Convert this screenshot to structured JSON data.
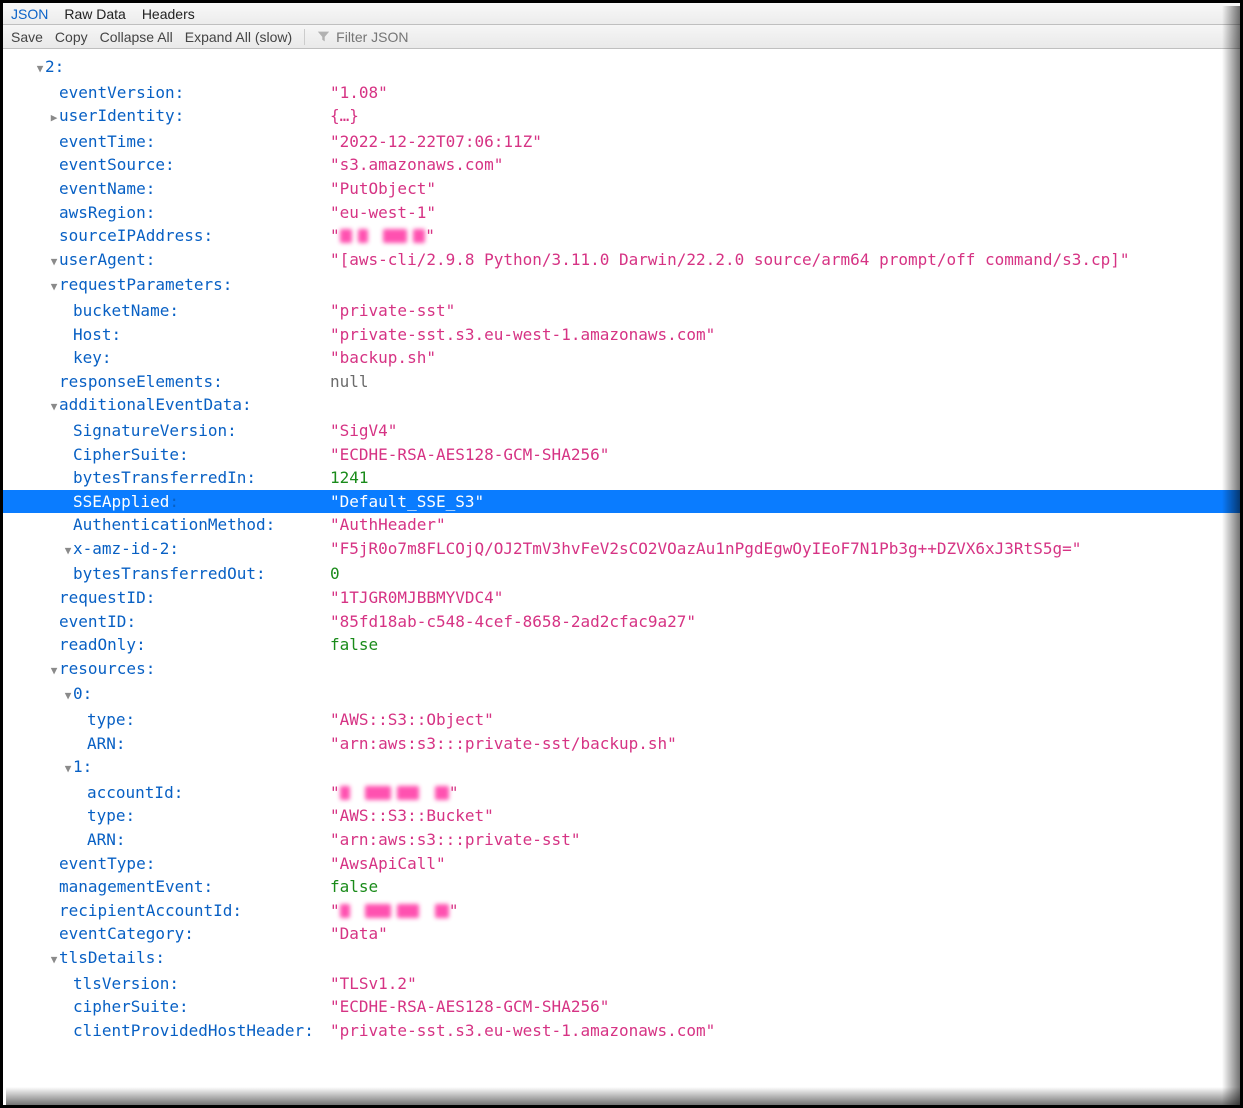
{
  "tabs": {
    "json": "JSON",
    "raw": "Raw Data",
    "headers": "Headers"
  },
  "toolbar": {
    "save": "Save",
    "copy": "Copy",
    "collapse": "Collapse All",
    "expand": "Expand All (slow)",
    "filter_placeholder": "Filter JSON"
  },
  "rows": [
    {
      "indent": 1,
      "arrow": "down",
      "key": "2",
      "value": "",
      "color": "",
      "hl": false
    },
    {
      "indent": 2,
      "arrow": "",
      "key": "eventVersion",
      "value": "\"1.08\"",
      "color": "str",
      "hl": false
    },
    {
      "indent": 2,
      "arrow": "right",
      "key": "userIdentity",
      "value": "{…}",
      "color": "obj",
      "hl": false
    },
    {
      "indent": 2,
      "arrow": "",
      "key": "eventTime",
      "value": "\"2022-12-22T07:06:11Z\"",
      "color": "str",
      "hl": false
    },
    {
      "indent": 2,
      "arrow": "",
      "key": "eventSource",
      "value": "\"s3.amazonaws.com\"",
      "color": "str",
      "hl": false
    },
    {
      "indent": 2,
      "arrow": "",
      "key": "eventName",
      "value": "\"PutObject\"",
      "color": "str",
      "hl": false
    },
    {
      "indent": 2,
      "arrow": "",
      "key": "awsRegion",
      "value": "\"eu-west-1\"",
      "color": "str",
      "hl": false
    },
    {
      "indent": 2,
      "arrow": "",
      "key": "sourceIPAddress",
      "value": "__REDACT_IP__",
      "color": "str",
      "hl": false
    },
    {
      "indent": 2,
      "arrow": "down",
      "key": "userAgent",
      "value": "\"[aws-cli/2.9.8 Python/3.11.0 Darwin/22.2.0 source/arm64 prompt/off command/s3.cp]\"",
      "color": "str",
      "hl": false
    },
    {
      "indent": 2,
      "arrow": "down",
      "key": "requestParameters",
      "value": "",
      "color": "",
      "hl": false
    },
    {
      "indent": 3,
      "arrow": "",
      "key": "bucketName",
      "value": "\"private-sst\"",
      "color": "str",
      "hl": false
    },
    {
      "indent": 3,
      "arrow": "",
      "key": "Host",
      "value": "\"private-sst.s3.eu-west-1.amazonaws.com\"",
      "color": "str",
      "hl": false
    },
    {
      "indent": 3,
      "arrow": "",
      "key": "key",
      "value": "\"backup.sh\"",
      "color": "str",
      "hl": false
    },
    {
      "indent": 2,
      "arrow": "",
      "key": "responseElements",
      "value": "null",
      "color": "null",
      "hl": false
    },
    {
      "indent": 2,
      "arrow": "down",
      "key": "additionalEventData",
      "value": "",
      "color": "",
      "hl": false
    },
    {
      "indent": 3,
      "arrow": "",
      "key": "SignatureVersion",
      "value": "\"SigV4\"",
      "color": "str",
      "hl": false
    },
    {
      "indent": 3,
      "arrow": "",
      "key": "CipherSuite",
      "value": "\"ECDHE-RSA-AES128-GCM-SHA256\"",
      "color": "str",
      "hl": false
    },
    {
      "indent": 3,
      "arrow": "",
      "key": "bytesTransferredIn",
      "value": "1241",
      "color": "num",
      "hl": false
    },
    {
      "indent": 3,
      "arrow": "",
      "key": "SSEApplied",
      "value": "\"Default_SSE_S3\"",
      "color": "str",
      "hl": true
    },
    {
      "indent": 3,
      "arrow": "",
      "key": "AuthenticationMethod",
      "value": "\"AuthHeader\"",
      "color": "str",
      "hl": false
    },
    {
      "indent": 3,
      "arrow": "down",
      "key": "x-amz-id-2",
      "value": "\"F5jR0o7m8FLCOjQ/OJ2TmV3hvFeV2sCO2VOazAu1nPgdEgwOyIEoF7N1Pb3g++DZVX6xJ3RtS5g=\"",
      "color": "str",
      "hl": false
    },
    {
      "indent": 3,
      "arrow": "",
      "key": "bytesTransferredOut",
      "value": "0",
      "color": "num",
      "hl": false
    },
    {
      "indent": 2,
      "arrow": "",
      "key": "requestID",
      "value": "\"1TJGR0MJBBMYVDC4\"",
      "color": "str",
      "hl": false
    },
    {
      "indent": 2,
      "arrow": "",
      "key": "eventID",
      "value": "\"85fd18ab-c548-4cef-8658-2ad2cfac9a27\"",
      "color": "str",
      "hl": false
    },
    {
      "indent": 2,
      "arrow": "",
      "key": "readOnly",
      "value": "false",
      "color": "bool",
      "hl": false
    },
    {
      "indent": 2,
      "arrow": "down",
      "key": "resources",
      "value": "",
      "color": "",
      "hl": false
    },
    {
      "indent": 3,
      "arrow": "down",
      "key": "0",
      "value": "",
      "color": "",
      "hl": false
    },
    {
      "indent": 4,
      "arrow": "",
      "key": "type",
      "value": "\"AWS::S3::Object\"",
      "color": "str",
      "hl": false
    },
    {
      "indent": 4,
      "arrow": "",
      "key": "ARN",
      "value": "\"arn:aws:s3:::private-sst/backup.sh\"",
      "color": "str",
      "hl": false
    },
    {
      "indent": 3,
      "arrow": "down",
      "key": "1",
      "value": "",
      "color": "",
      "hl": false
    },
    {
      "indent": 4,
      "arrow": "",
      "key": "accountId",
      "value": "__REDACT_ACCT__",
      "color": "str",
      "hl": false
    },
    {
      "indent": 4,
      "arrow": "",
      "key": "type",
      "value": "\"AWS::S3::Bucket\"",
      "color": "str",
      "hl": false
    },
    {
      "indent": 4,
      "arrow": "",
      "key": "ARN",
      "value": "\"arn:aws:s3:::private-sst\"",
      "color": "str",
      "hl": false
    },
    {
      "indent": 2,
      "arrow": "",
      "key": "eventType",
      "value": "\"AwsApiCall\"",
      "color": "str",
      "hl": false
    },
    {
      "indent": 2,
      "arrow": "",
      "key": "managementEvent",
      "value": "false",
      "color": "bool",
      "hl": false
    },
    {
      "indent": 2,
      "arrow": "",
      "key": "recipientAccountId",
      "value": "__REDACT_ACCT__",
      "color": "str",
      "hl": false
    },
    {
      "indent": 2,
      "arrow": "",
      "key": "eventCategory",
      "value": "\"Data\"",
      "color": "str",
      "hl": false
    },
    {
      "indent": 2,
      "arrow": "down",
      "key": "tlsDetails",
      "value": "",
      "color": "",
      "hl": false
    },
    {
      "indent": 3,
      "arrow": "",
      "key": "tlsVersion",
      "value": "\"TLSv1.2\"",
      "color": "str",
      "hl": false
    },
    {
      "indent": 3,
      "arrow": "",
      "key": "cipherSuite",
      "value": "\"ECDHE-RSA-AES128-GCM-SHA256\"",
      "color": "str",
      "hl": false
    },
    {
      "indent": 3,
      "arrow": "",
      "key": "clientProvidedHostHeader",
      "value": "\"private-sst.s3.eu-west-1.amazonaws.com\"",
      "color": "str",
      "hl": false
    }
  ]
}
